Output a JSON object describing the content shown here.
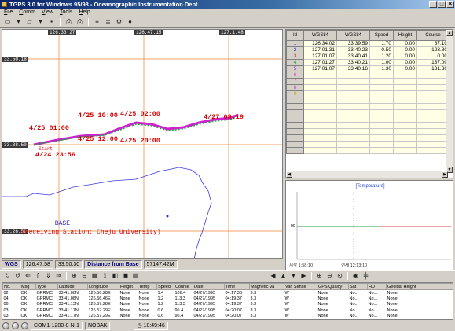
{
  "window": {
    "title": "TGPS 3.0 for Windows 95/98 - Oceanographic Instrumentation Dept.",
    "min": "_",
    "max": "□",
    "close": "×"
  },
  "menu": [
    "File",
    "Comm",
    "View",
    "Tools",
    "Help"
  ],
  "map": {
    "top_coords": [
      "126.33.27",
      "126.47.15",
      "127.1.48"
    ],
    "left_coords": [
      "33.50.18",
      "33.38.50",
      "33.26.59"
    ],
    "annotations": [
      "4/25 10:00",
      "4/25 02:00",
      "4/27 08:19",
      "4/25 01:00",
      "4/25 12:00",
      "4/25 20:00",
      "Start",
      "4/24 23:56"
    ],
    "base_label": "+BASE",
    "receiving_label": "(Receiving Station: Cheju University)"
  },
  "map_status": {
    "system": "WGS",
    "lon": "126.47.58",
    "lat": "33.50.30",
    "distance_label": "Distance from Base",
    "distance": "57147.42M"
  },
  "grid": {
    "headers": [
      "Id",
      "WGS84",
      "WGS84",
      "Speed",
      "Height",
      "Course"
    ],
    "rows": [
      [
        "1",
        "126.34.02",
        "33.39.59",
        "1.70",
        "0.00",
        "67.10"
      ],
      [
        "2",
        "127.01.31",
        "33.40.23",
        "0.50",
        "0.00",
        "123.80"
      ],
      [
        "3",
        "127.01.07",
        "33.40.41",
        "1.20",
        "0.00",
        "0.00"
      ],
      [
        "4",
        "127.01.27",
        "33.40.21",
        "1.00",
        "0.00",
        "137.00"
      ],
      [
        "5",
        "127.01.07",
        "33.40.16",
        "1.30",
        "0.00",
        "131.30"
      ],
      [
        "6",
        "",
        "",
        "",
        "",
        ""
      ],
      [
        "7",
        "",
        "",
        "",
        "",
        ""
      ],
      [
        "8",
        "",
        "",
        "",
        "",
        ""
      ],
      [
        "9",
        "",
        "",
        "",
        "",
        ""
      ],
      [
        "",
        "",
        "",
        "",
        "",
        ""
      ],
      [
        "",
        "",
        "",
        "",
        "",
        ""
      ],
      [
        "",
        "",
        "",
        "",
        "",
        ""
      ],
      [
        "",
        "",
        "",
        "",
        "",
        ""
      ],
      [
        "",
        "",
        "",
        "",
        "",
        ""
      ],
      [
        "",
        "",
        "",
        "",
        "",
        ""
      ],
      [
        "",
        "",
        "",
        "",
        "",
        ""
      ],
      [
        "",
        "",
        "",
        "",
        "",
        ""
      ],
      [
        "",
        "",
        "",
        "",
        "",
        ""
      ]
    ]
  },
  "temperature": {
    "title": "[Temperature]",
    "value_label": "-99",
    "foot1": "시작 1:58:10",
    "foot2": "현재 12:13:10"
  },
  "log": {
    "headers": [
      "No.",
      "Msg",
      "Type",
      "Latitude",
      "Longitude",
      "Height",
      "Temp",
      "Speed",
      "Course",
      "Date",
      "Time",
      "Magnetic Va",
      "Var. Sense",
      "GPS Quality",
      "Sat",
      "HD",
      "Geoidal Height"
    ],
    "rows": [
      [
        "02",
        "OK",
        "GPRMC",
        "33.41.08N",
        "126.56.28E",
        "None",
        "None",
        "1.4",
        "106.4",
        "04/27/1995",
        "04:17:38",
        "3.3",
        "W",
        "None",
        "No...",
        "No...",
        "None"
      ],
      [
        "04",
        "OK",
        "GPRMC",
        "33.41.08N",
        "126.56.46E",
        "None",
        "None",
        "1.2",
        "113.3",
        "04/27/1995",
        "04:19:37",
        "3.3",
        "W",
        "None",
        "No...",
        "No...",
        "None"
      ],
      [
        "06",
        "OK",
        "GPRMC",
        "33.41.13N",
        "126.57.28E",
        "None",
        "None",
        "1.2",
        "113.3",
        "04/27/1995",
        "04:19:37",
        "3.3",
        "W",
        "None",
        "No...",
        "No...",
        "None"
      ],
      [
        "03",
        "OK",
        "GPRMC",
        "33.41.17N",
        "126.57.29E",
        "None",
        "None",
        "0.6",
        "96.4",
        "04/27/1995",
        "04:20:07",
        "3.3",
        "W",
        "None",
        "No...",
        "No...",
        "None"
      ],
      [
        "03",
        "OK",
        "GPRMC",
        "33.41.17N",
        "126.57.29E",
        "None",
        "None",
        "0.6",
        "96.4",
        "04/27/1995",
        "04:20:07",
        "3.3",
        "W",
        "None",
        "No...",
        "No...",
        "None"
      ]
    ]
  },
  "status": {
    "port": "COM1-1200-8-N-1",
    "nobak": "NOBAK",
    "clock": "10:49:46"
  }
}
